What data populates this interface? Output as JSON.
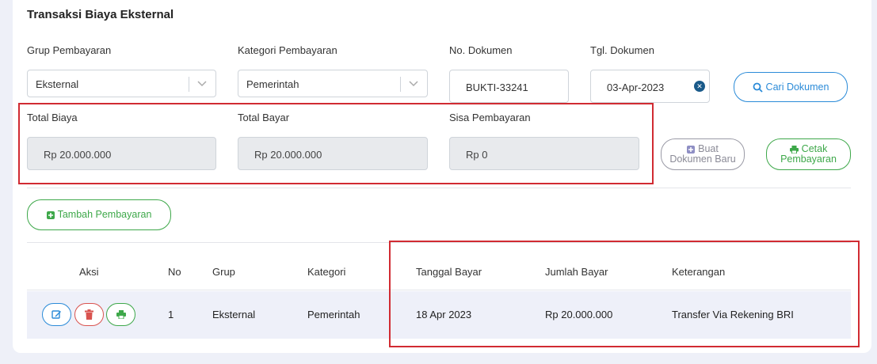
{
  "page": {
    "title": "Transaksi Biaya Eksternal"
  },
  "filters": {
    "grup_label": "Grup Pembayaran",
    "grup_value": "Eksternal",
    "kategori_label": "Kategori Pembayaran",
    "kategori_value": "Pemerintah",
    "nodok_label": "No. Dokumen",
    "nodok_value": "BUKTI-33241",
    "tgl_label": "Tgl. Dokumen",
    "tgl_value": "03-Apr-2023",
    "search_button": "Cari Dokumen"
  },
  "summary": {
    "total_biaya_label": "Total Biaya",
    "total_biaya_value": "Rp 20.000.000",
    "total_bayar_label": "Total Bayar",
    "total_bayar_value": "Rp 20.000.000",
    "sisa_label": "Sisa Pembayaran",
    "sisa_value": "Rp 0"
  },
  "actions": {
    "buat_line1": "Buat",
    "buat_line2": "Dokumen Baru",
    "cetak_line1": "Cetak",
    "cetak_line2": "Pembayaran",
    "tambah": "Tambah Pembayaran"
  },
  "table": {
    "headers": [
      "Aksi",
      "No",
      "Grup",
      "Kategori",
      "Tanggal Bayar",
      "Jumlah Bayar",
      "Keterangan"
    ],
    "rows": [
      {
        "no": "1",
        "grup": "Eksternal",
        "kategori": "Pemerintah",
        "tanggal": "18 Apr 2023",
        "jumlah": "Rp 20.000.000",
        "keterangan": "Transfer Via Rekening BRI"
      }
    ]
  },
  "colors": {
    "accent_blue": "#2b8bd8",
    "accent_green": "#3ea84a",
    "danger_red": "#d9534f",
    "highlight_red": "#d12b32"
  }
}
